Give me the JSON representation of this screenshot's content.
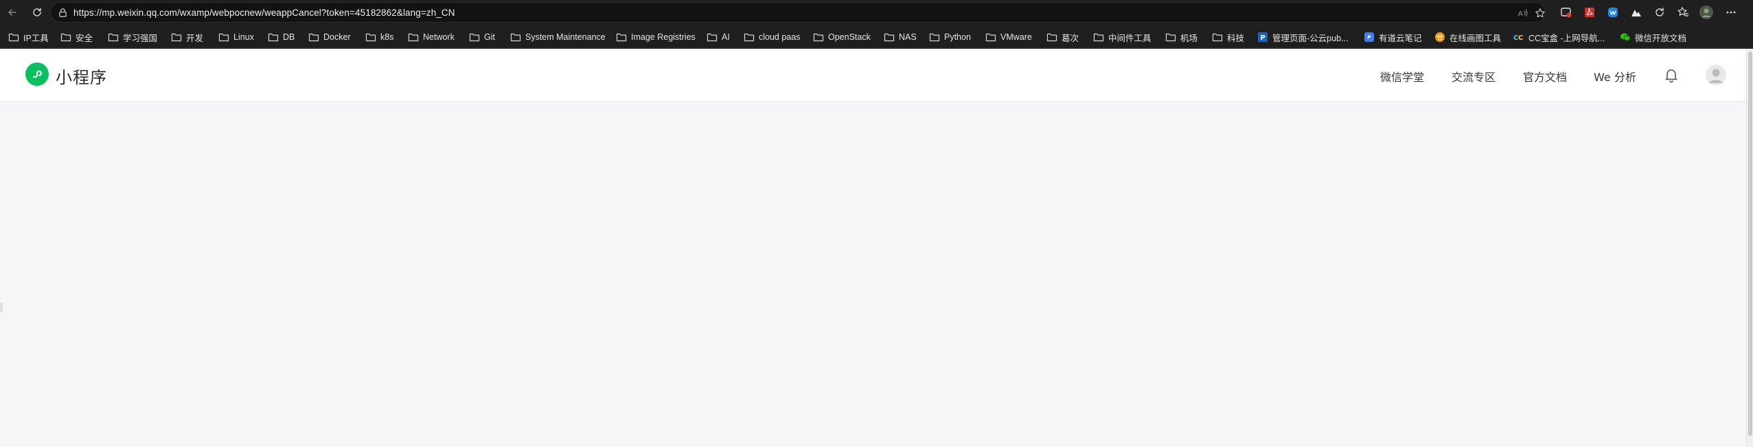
{
  "browser": {
    "url": "https://mp.weixin.qq.com/wxamp/webpocnew/weappCancel?token=45182862&lang=zh_CN",
    "colors": {
      "toolbar": "#1f1f1f",
      "omnibox": "#121212"
    }
  },
  "bookmarks": [
    {
      "label": "IP工具",
      "icon": "folder-icon"
    },
    {
      "label": "安全",
      "icon": "folder-icon"
    },
    {
      "label": "学习强国",
      "icon": "folder-icon"
    },
    {
      "label": "开发",
      "icon": "folder-icon"
    },
    {
      "label": "Linux",
      "icon": "folder-icon"
    },
    {
      "label": "DB",
      "icon": "folder-icon"
    },
    {
      "label": "Docker",
      "icon": "folder-icon"
    },
    {
      "label": "k8s",
      "icon": "folder-icon"
    },
    {
      "label": "Network",
      "icon": "folder-icon"
    },
    {
      "label": "Git",
      "icon": "folder-icon"
    },
    {
      "label": "System Maintenance",
      "icon": "folder-icon"
    },
    {
      "label": "Image Registries",
      "icon": "folder-icon"
    },
    {
      "label": "AI",
      "icon": "folder-icon"
    },
    {
      "label": "cloud paas",
      "icon": "folder-icon"
    },
    {
      "label": "OpenStack",
      "icon": "folder-icon"
    },
    {
      "label": "NAS",
      "icon": "folder-icon"
    },
    {
      "label": "Python",
      "icon": "folder-icon"
    },
    {
      "label": "VMware",
      "icon": "folder-icon"
    },
    {
      "label": "葛次",
      "icon": "folder-icon"
    },
    {
      "label": "中间件工具",
      "icon": "folder-icon"
    },
    {
      "label": "机场",
      "icon": "folder-icon"
    },
    {
      "label": "科技",
      "icon": "folder-icon"
    },
    {
      "label": "管理页面-公云pub...",
      "icon": "p-site-icon"
    },
    {
      "label": "有道云笔记",
      "icon": "youdao-note-icon"
    },
    {
      "label": "在线画图工具",
      "icon": "drawing-tool-icon"
    },
    {
      "label": "CC宝盒 -上网导航...",
      "icon": "cc-navigator-icon"
    },
    {
      "label": "微信开放文档",
      "icon": "wechat-icon"
    }
  ],
  "site": {
    "title": "小程序",
    "nav": [
      "微信学堂",
      "交流专区",
      "官方文档",
      "We 分析"
    ],
    "brand_color": "#07c160"
  }
}
